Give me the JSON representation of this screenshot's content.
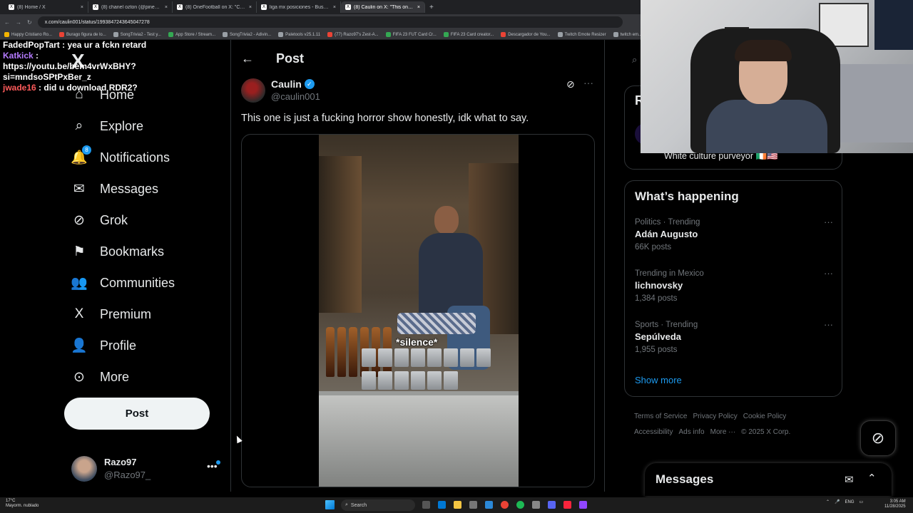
{
  "browser": {
    "tabs": [
      {
        "label": "(8) Home / X",
        "active": false
      },
      {
        "label": "(8) chanel ozton (@pineapple...",
        "active": false
      },
      {
        "label": "(8) OneFootball on X: \"Cristian...",
        "active": false
      },
      {
        "label": "liga mx posiciones - Buscar co...",
        "active": false
      },
      {
        "label": "(8) Caulin on X: \"This one is...",
        "active": true
      }
    ],
    "new_tab": "+",
    "url": "x.com/caulin001/status/1993847243645047278",
    "bookmarks": [
      {
        "label": "Happy Cristiano Ro...",
        "color": "#f4b400"
      },
      {
        "label": "Burago figura de lo...",
        "color": "#ea4335"
      },
      {
        "label": "SongTrivia2 - Test y...",
        "color": "#9aa0a6"
      },
      {
        "label": "App Store / Stream...",
        "color": "#34a853"
      },
      {
        "label": "SongTrivia2 - Adivin...",
        "color": "#9aa0a6"
      },
      {
        "label": "Paletools v25.1.11",
        "color": "#9aa0a6"
      },
      {
        "label": "(77) Razo97's Zest-A...",
        "color": "#ea4335"
      },
      {
        "label": "FIFA 23 FUT Card Cr...",
        "color": "#34a853"
      },
      {
        "label": "FIFA 23 Card creator...",
        "color": "#34a853"
      },
      {
        "label": "Descargador de You...",
        "color": "#ea4335"
      },
      {
        "label": "Twitch Emote Resizer",
        "color": "#9aa0a6"
      },
      {
        "label": "twitch em...",
        "color": "#9aa0a6"
      }
    ]
  },
  "chat": {
    "line1": "FadedPopTart : yea ur a fckn retard",
    "user2": "Katkick",
    "msg2": ": https://youtu.be/bem4vrWxBHY?si=mndsoSPtPxBer_z",
    "user3": "jwade16",
    "msg3": ": did u download RDR2?"
  },
  "nav": {
    "logo": "X",
    "items": [
      {
        "label": "Home",
        "icon": "home-icon",
        "glyph": "⌂"
      },
      {
        "label": "Explore",
        "icon": "search-icon",
        "glyph": "⌕"
      },
      {
        "label": "Notifications",
        "icon": "bell-icon",
        "glyph": "🔔"
      },
      {
        "label": "Messages",
        "icon": "envelope-icon",
        "glyph": "✉"
      },
      {
        "label": "Grok",
        "icon": "grok-icon",
        "glyph": "⊘"
      },
      {
        "label": "Bookmarks",
        "icon": "bookmark-icon",
        "glyph": "⚑"
      },
      {
        "label": "Communities",
        "icon": "people-icon",
        "glyph": "👥"
      },
      {
        "label": "Premium",
        "icon": "x-premium-icon",
        "glyph": "X"
      },
      {
        "label": "Profile",
        "icon": "person-icon",
        "glyph": "👤"
      },
      {
        "label": "More",
        "icon": "more-circle-icon",
        "glyph": "⊙"
      }
    ],
    "notifications_badge": "8",
    "post_button": "Post",
    "account": {
      "name": "Razo97",
      "handle": "@Razo97_",
      "more": "•••"
    }
  },
  "post": {
    "header_title": "Post",
    "back_glyph": "←",
    "author_name": "Caulin",
    "author_handle": "@caulin001",
    "verified_glyph": "✓",
    "grok_glyph": "⊘",
    "more_glyph": "···",
    "text": "This one is just a fucking horror show honestly, idk what to say.",
    "video_caption": "*silence*"
  },
  "right": {
    "search_glyph": "⌕",
    "who_to_follow_letter": "R",
    "bio": "White culture purveyor 🇮🇪🇺🇸",
    "whats_happening_title": "What’s happening",
    "trends": [
      {
        "context": "Politics · Trending",
        "name": "Adán Augusto",
        "count": "66K posts"
      },
      {
        "context": "Trending in Mexico",
        "name": "lichnovsky",
        "count": "1,384 posts"
      },
      {
        "context": "Sports · Trending",
        "name": "Sepúlveda",
        "count": "1,955 posts"
      }
    ],
    "trend_more": "···",
    "show_more": "Show more",
    "footer": [
      "Terms of Service",
      "Privacy Policy",
      "Cookie Policy",
      "Accessibility",
      "Ads info",
      "More ···",
      "© 2025 X Corp."
    ],
    "messages_title": "Messages"
  },
  "taskbar": {
    "weather_temp": "17°C",
    "weather_desc": "Mayorm. nublado",
    "search": "Search",
    "lang": "ENG",
    "time": "3:05 AM",
    "date": "11/28/2025"
  }
}
